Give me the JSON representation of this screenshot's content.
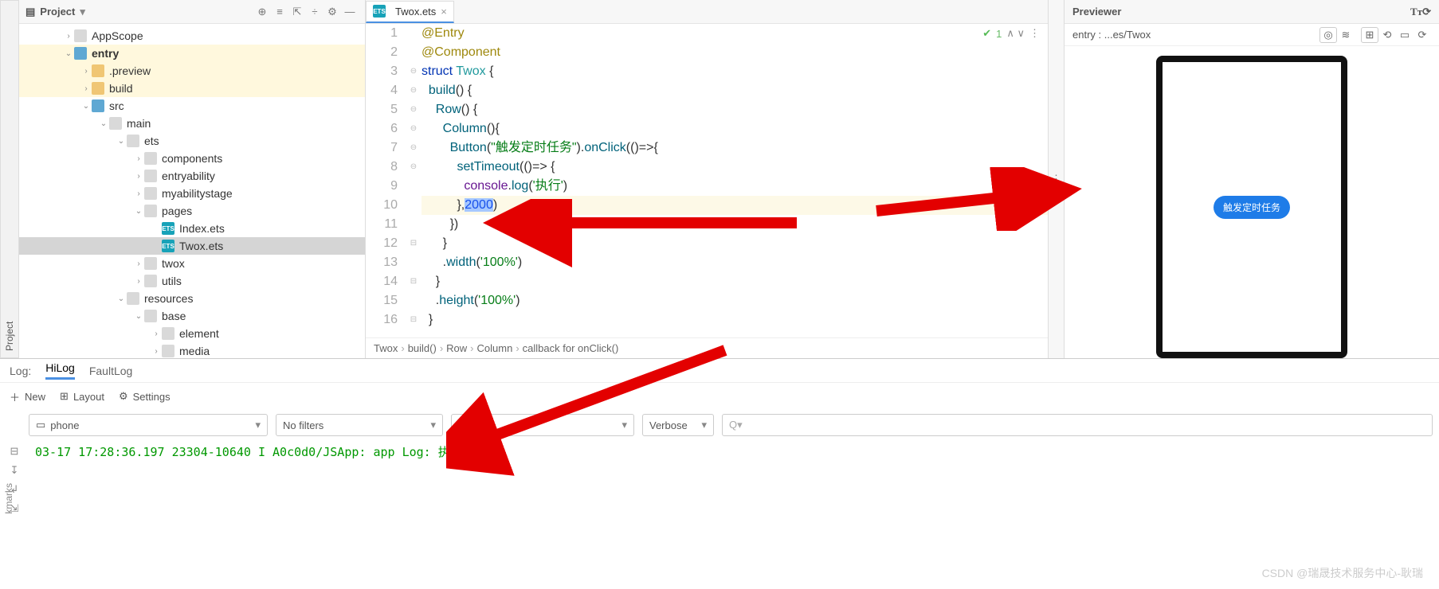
{
  "project_panel": {
    "title": "Project"
  },
  "vtabs": {
    "project": "Project",
    "bookmarks": "kmarks"
  },
  "tree": [
    {
      "depth": 0,
      "arrow": "right",
      "icon": "folder",
      "label": "AppScope"
    },
    {
      "depth": 0,
      "arrow": "down",
      "icon": "folder-b",
      "label": "entry",
      "bold": true,
      "hilite": true
    },
    {
      "depth": 1,
      "arrow": "right",
      "icon": "folder-y",
      "label": ".preview",
      "hilite": true
    },
    {
      "depth": 1,
      "arrow": "right",
      "icon": "folder-y",
      "label": "build",
      "hilite": true
    },
    {
      "depth": 1,
      "arrow": "down",
      "icon": "folder-b",
      "label": "src"
    },
    {
      "depth": 2,
      "arrow": "down",
      "icon": "folder",
      "label": "main"
    },
    {
      "depth": 3,
      "arrow": "down",
      "icon": "folder",
      "label": "ets"
    },
    {
      "depth": 4,
      "arrow": "right",
      "icon": "folder",
      "label": "components"
    },
    {
      "depth": 4,
      "arrow": "right",
      "icon": "folder",
      "label": "entryability"
    },
    {
      "depth": 4,
      "arrow": "right",
      "icon": "folder",
      "label": "myabilitystage"
    },
    {
      "depth": 4,
      "arrow": "down",
      "icon": "folder",
      "label": "pages"
    },
    {
      "depth": 5,
      "arrow": "none",
      "icon": "ets",
      "label": "Index.ets"
    },
    {
      "depth": 5,
      "arrow": "none",
      "icon": "ets",
      "label": "Twox.ets",
      "selected": true
    },
    {
      "depth": 4,
      "arrow": "right",
      "icon": "folder",
      "label": "twox"
    },
    {
      "depth": 4,
      "arrow": "right",
      "icon": "folder",
      "label": "utils"
    },
    {
      "depth": 3,
      "arrow": "down",
      "icon": "folder",
      "label": "resources"
    },
    {
      "depth": 4,
      "arrow": "down",
      "icon": "folder",
      "label": "base"
    },
    {
      "depth": 5,
      "arrow": "right",
      "icon": "folder",
      "label": "element"
    },
    {
      "depth": 5,
      "arrow": "right",
      "icon": "folder",
      "label": "media"
    }
  ],
  "editor": {
    "tab": "Twox.ets",
    "status_count": "1"
  },
  "code_tokens": [
    [
      [
        "tok-ann",
        "@Entry"
      ]
    ],
    [
      [
        "tok-ann",
        "@Component"
      ]
    ],
    [
      [
        "tok-kw",
        "struct "
      ],
      [
        "tok-type",
        "Twox"
      ],
      [
        "",
        " {"
      ]
    ],
    [
      [
        "",
        "  "
      ],
      [
        "tok-fn",
        "build"
      ],
      [
        "",
        "() {"
      ]
    ],
    [
      [
        "",
        "    "
      ],
      [
        "tok-fn",
        "Row"
      ],
      [
        "",
        "() {"
      ]
    ],
    [
      [
        "",
        "      "
      ],
      [
        "tok-fn",
        "Column"
      ],
      [
        "",
        "(){"
      ]
    ],
    [
      [
        "",
        "        "
      ],
      [
        "tok-fn",
        "Button"
      ],
      [
        "",
        "("
      ],
      [
        "tok-str",
        "\"触发定时任务\""
      ],
      [
        "",
        ")."
      ],
      [
        "tok-fn",
        "onClick"
      ],
      [
        "",
        "(()=>{"
      ]
    ],
    [
      [
        "",
        "          "
      ],
      [
        "tok-fn",
        "setTimeout"
      ],
      [
        "",
        "(()=> {"
      ]
    ],
    [
      [
        "",
        "            "
      ],
      [
        "tok-id",
        "console"
      ],
      [
        "",
        "."
      ],
      [
        "tok-fn",
        "log"
      ],
      [
        "",
        "("
      ],
      [
        "tok-str",
        "'执行'"
      ],
      [
        "",
        ")"
      ]
    ],
    [
      [
        "",
        "          },"
      ],
      [
        "selection tok-num",
        "2000"
      ],
      [
        "",
        ")"
      ]
    ],
    [
      [
        "",
        "        })"
      ]
    ],
    [
      [
        "",
        "      }"
      ]
    ],
    [
      [
        "",
        "      ."
      ],
      [
        "tok-fn",
        "width"
      ],
      [
        "",
        "("
      ],
      [
        "tok-str",
        "'100%'"
      ],
      [
        "",
        ")"
      ]
    ],
    [
      [
        "",
        "    }"
      ]
    ],
    [
      [
        "",
        "    ."
      ],
      [
        "tok-fn",
        "height"
      ],
      [
        "",
        "("
      ],
      [
        "tok-str",
        "'100%'"
      ],
      [
        "",
        ")"
      ]
    ],
    [
      [
        "",
        "  }"
      ]
    ]
  ],
  "code_current_line": 10,
  "breadcrumb": [
    "Twox",
    "build()",
    "Row",
    "Column",
    "callback for onClick()"
  ],
  "preview": {
    "title": "Previewer",
    "path": "entry : ...es/Twox",
    "button": "触发定时任务"
  },
  "log": {
    "tabs": {
      "log": "Log:",
      "hilog": "HiLog",
      "faultlog": "FaultLog"
    },
    "toolbar": {
      "new": "New",
      "layout": "Layout",
      "settings": "Settings"
    },
    "filters": {
      "device": "phone",
      "filter": "No filters",
      "level": "Verbose",
      "search_ph": "Q▾"
    },
    "line": "03-17 17:28:36.197 23304-10640 I A0c0d0/JSApp: app Log: 执行"
  },
  "watermark": "CSDN @瑞晟技术服务中心-耿瑞"
}
